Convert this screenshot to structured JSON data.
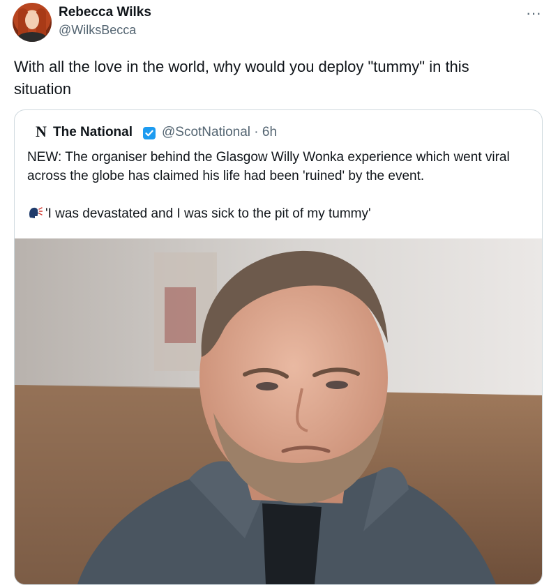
{
  "tweet": {
    "author_name": "Rebecca Wilks",
    "author_handle": "@WilksBecca",
    "more_icon": "ellipsis-icon",
    "more_glyph": "···",
    "text": "With all the love in the world, why would you deploy \"tummy\" in this situation"
  },
  "quoted_tweet": {
    "logo_letter": "N",
    "name": "The National",
    "verified_icon": "verified-badge-icon",
    "handle_time": "@ScotNational · 6h",
    "text": "NEW: The organiser behind the Glasgow Willy Wonka experience which went viral across the globe has claimed his life had been 'ruined' by the event.",
    "quote_icon": "speaking-head-icon",
    "quote": "'I was devastated and I was sick to the pit of my tummy'"
  },
  "colors": {
    "text": "#0f1419",
    "secondary": "#536471",
    "border": "#cfd9de",
    "verified_blue": "#1d9bf0"
  }
}
